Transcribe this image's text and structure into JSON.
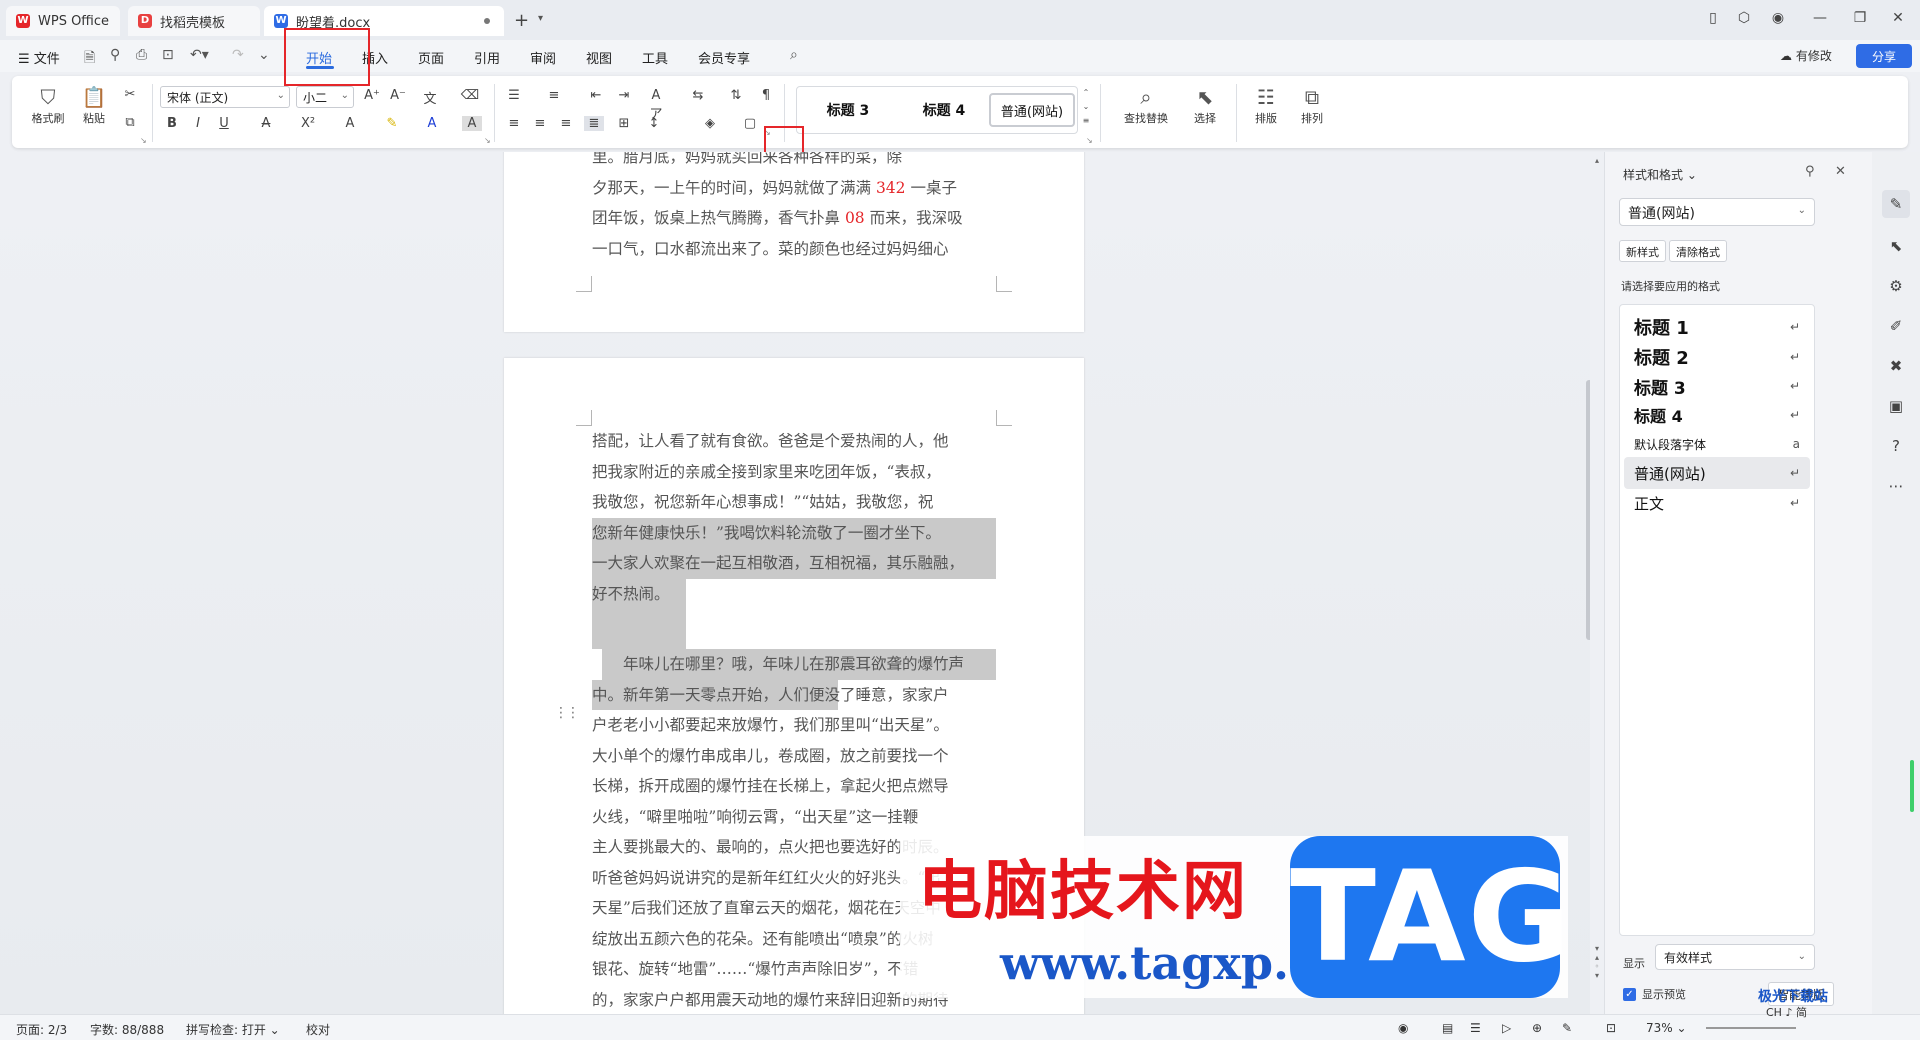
{
  "tabs": [
    {
      "label": "WPS Office",
      "icon": "wps-logo-icon"
    },
    {
      "label": "找稻壳模板",
      "icon": "docer-icon"
    },
    {
      "label": "盼望着.docx",
      "icon": "word-doc-icon"
    }
  ],
  "menu": {
    "file_label": "文件",
    "items": [
      "开始",
      "插入",
      "页面",
      "引用",
      "审阅",
      "视图",
      "工具",
      "会员专享"
    ],
    "active": "开始",
    "edit_status": "有修改",
    "share_label": "分享"
  },
  "ribbon": {
    "format_painter": "格式刷",
    "paste": "粘贴",
    "font_name": "宋体 (正文)",
    "font_size": "小二",
    "styles": [
      "标题 3",
      "标题 4",
      "普通(网站)"
    ],
    "find_replace": "查找替换",
    "select": "选择",
    "layout": "排版",
    "arrange": "排列"
  },
  "page1_lines": [
    "里。腊月底，妈妈就买回来各种各样的菜，除",
    "夕那天，一上午的时间，妈妈就做了满满 342 一桌子",
    "团年饭，饭桌上热气腾腾，香气扑鼻 08 而来，我深吸",
    "一口气，口水都流出来了。菜的颜色也经过妈妈细心"
  ],
  "page2_lines": [
    "搭配，让人看了就有食欲。爸爸是个爱热闹的人，他",
    "把我家附近的亲戚全接到家里来吃团年饭，“表叔，",
    "我敬您，祝您新年心想事成！”“姑姑，我敬您，祝",
    "您新年健康快乐！”我喝饮料轮流敬了一圈才坐下。",
    "一大家人欢聚在一起互相敬酒，互相祝福，其乐融融，",
    "好不热闹。",
    "",
    "　　年味儿在哪里？哦，年味儿在那震耳欲聋的爆竹声",
    "中。新年第一天零点开始，人们便没了睡意，家家户",
    "户老老小小都要起来放爆竹，我们那里叫“出天星”。",
    "大小单个的爆竹串成串儿，卷成圈，放之前要找一个",
    "长梯，拆开成圈的爆竹挂在长梯上，拿起火把点燃导",
    "火线，“噼里啪啦”响彻云霄，“出天星”这一挂鞭",
    "主人要挑最大的、最响的，点火把也要选好的时辰。",
    "听爸爸妈妈说讲究的是新年红红火火的好兆头。“出",
    "天星”后我们还放了直窜云天的烟花，烟花在天空中",
    "绽放出五颜六色的花朵。还有能喷出“喷泉”的火树",
    "银花、旋转“地雷”……“爆竹声声除旧岁”，不错",
    "的，家家户户都用震天动地的爆竹来辞旧迎新的期待"
  ],
  "panel": {
    "title": "样式和格式",
    "current_style": "普通(网站)",
    "new_style": "新样式",
    "clear_format": "清除格式",
    "apply_label": "请选择要应用的格式",
    "styles": [
      "标题 1",
      "标题 2",
      "标题 3",
      "标题 4",
      "默认段落字体",
      "普通(网站)",
      "正文"
    ],
    "show_label": "显示",
    "show_value": "有效样式",
    "preview_label": "显示预览",
    "smart_layout": "智能排版"
  },
  "status": {
    "page": "页面: 2/3",
    "words": "字数: 88/888",
    "spell": "拼写检查: 打开",
    "proof": "校对",
    "zoom": "73%"
  },
  "watermark": {
    "site_title": "电脑技术网",
    "url": "www.tagxp.com",
    "tag": "TAG",
    "brand2": "极光下载站",
    "brand2_sub": "CH ♪ 简"
  },
  "colors": {
    "accent": "#2b6bde",
    "highlight_box": "#e5262a",
    "number_red": "#e5262a"
  }
}
